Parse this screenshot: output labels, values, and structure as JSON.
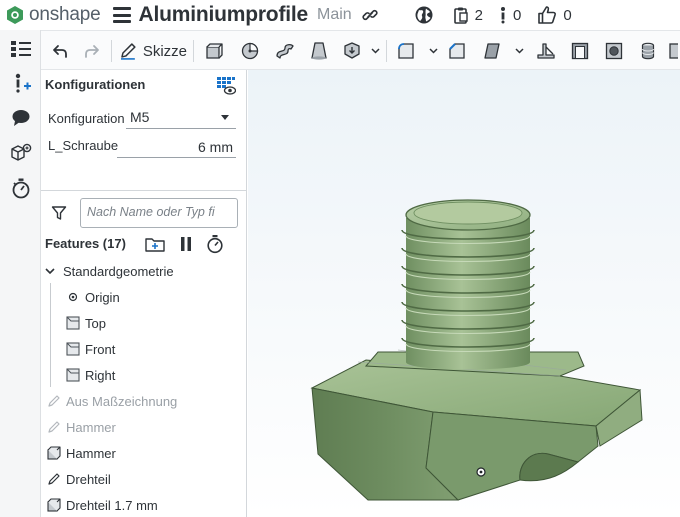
{
  "app": {
    "logo_text": "onshape",
    "document_title": "Aluminiumprofile",
    "branch": "Main",
    "copies_count": "2",
    "info_count": "0",
    "likes_count": "0"
  },
  "toolbar": {
    "sketch_label": "Skizze"
  },
  "config_panel": {
    "title": "Konfigurationen",
    "config_label": "Konfiguration",
    "config_value": "M5",
    "param_label": "L_Schraube",
    "param_value": "6 mm"
  },
  "feature_list": {
    "search_placeholder": "Nach Name oder Typ fi",
    "title": "Features (17)",
    "group": "Standardgeometrie",
    "items": [
      {
        "label": "Origin",
        "icon": "origin-icon"
      },
      {
        "label": "Top",
        "icon": "plane-icon"
      },
      {
        "label": "Front",
        "icon": "plane-icon"
      },
      {
        "label": "Right",
        "icon": "plane-icon"
      },
      {
        "label": "Aus Maßzeichnung",
        "icon": "sketch-icon"
      },
      {
        "label": "Hammer",
        "icon": "sketch-icon"
      },
      {
        "label": "Hammer",
        "icon": "extrude-icon"
      },
      {
        "label": "Drehteil",
        "icon": "sketch-icon"
      },
      {
        "label": "Drehteil 1.7 mm",
        "icon": "extrude-icon"
      }
    ]
  },
  "colors": {
    "accent_green": "#3d9a5a",
    "part_green": "#8fb07e",
    "part_dark": "#4f6a44"
  }
}
